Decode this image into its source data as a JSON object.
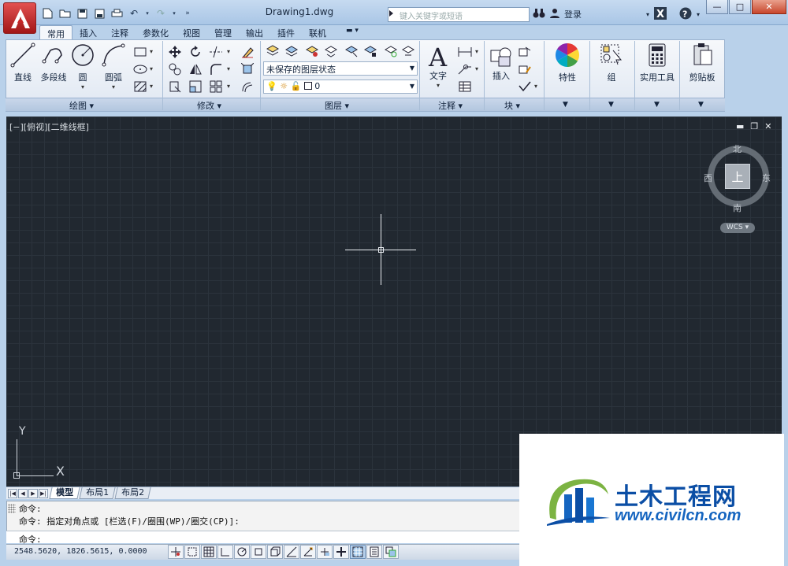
{
  "window": {
    "title": "Drawing1.dwg",
    "search_placeholder": "键入关键字或短语",
    "login_label": "登录",
    "minimize": "—",
    "maximize": "□",
    "close": "✕"
  },
  "ribbon": {
    "tabs": [
      "常用",
      "插入",
      "注释",
      "参数化",
      "视图",
      "管理",
      "输出",
      "插件",
      "联机"
    ],
    "active_tab": "常用",
    "draw_tools": {
      "line": "直线",
      "polyline": "多段线",
      "circle": "圆",
      "arc": "圆弧"
    },
    "panels": {
      "draw": "绘图 ▾",
      "modify": "修改 ▾",
      "layers": "图层 ▾",
      "annotation": "注释 ▾",
      "block": "块 ▾"
    },
    "layer_state": "未保存的图层状态",
    "current_layer": "0",
    "text_tool": "文字",
    "insert_tool": "插入",
    "properties_tool": "特性",
    "group_tool": "组",
    "utilities_tool": "实用工具",
    "clipboard_tool": "剪贴板"
  },
  "viewport": {
    "label": "[−][俯视][二维线框]",
    "viewcube": {
      "north": "北",
      "south": "南",
      "east": "东",
      "west": "西",
      "top": "上"
    },
    "wcs": "WCS ▾",
    "ucs_x": "X",
    "ucs_y": "Y"
  },
  "layout_tabs": [
    "模型",
    "布局1",
    "布局2"
  ],
  "active_layout": "模型",
  "command": {
    "line1": "命令:",
    "line2": "命令: 指定对角点或 [栏选(F)/圈围(WP)/圈交(CP)]:",
    "prompt": "命令:"
  },
  "status": {
    "coordinates": "2548.5620, 1826.5615, 0.0000"
  },
  "watermark": {
    "name": "土木工程网",
    "url": "www.civilcn.com"
  },
  "colors": {
    "canvas_bg": "#212830",
    "app_button": "#c62828",
    "watermark_blue": "#0b4ea5"
  }
}
